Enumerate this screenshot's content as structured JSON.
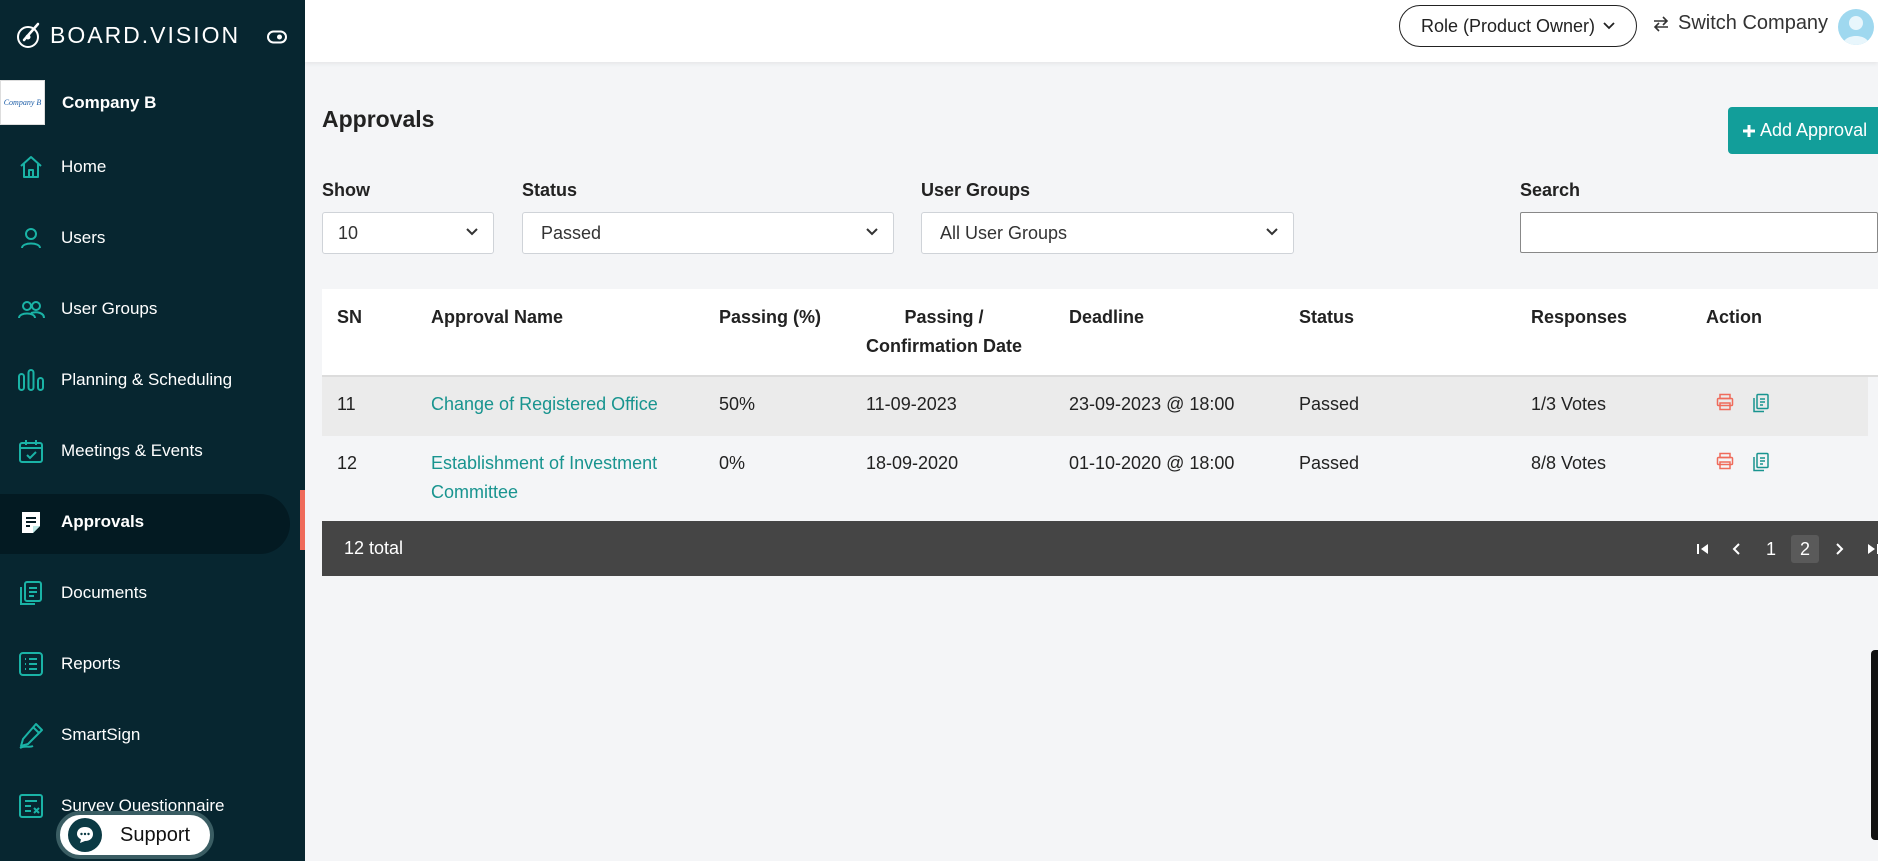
{
  "brand": {
    "name": "BOARD.VISION"
  },
  "company": {
    "logo_text": "Company B",
    "name": "Company B"
  },
  "sidebar": {
    "items": [
      {
        "label": "Home",
        "icon": "home-icon"
      },
      {
        "label": "Users",
        "icon": "user-icon"
      },
      {
        "label": "User Groups",
        "icon": "users-icon"
      },
      {
        "label": "Planning & Scheduling",
        "icon": "bar-chart-icon"
      },
      {
        "label": "Meetings & Events",
        "icon": "calendar-icon"
      },
      {
        "label": "Approvals",
        "icon": "approval-icon",
        "active": true
      },
      {
        "label": "Documents",
        "icon": "documents-icon"
      },
      {
        "label": "Reports",
        "icon": "list-icon"
      },
      {
        "label": "SmartSign",
        "icon": "pen-icon"
      },
      {
        "label": "Survey Questionnaire",
        "icon": "survey-icon"
      }
    ]
  },
  "support": {
    "label": "Support"
  },
  "header": {
    "role_label": "Role (Product Owner)",
    "switch_label": "Switch Company"
  },
  "page": {
    "title": "Approvals",
    "add_label": "Add Approval"
  },
  "filters": {
    "show": {
      "label": "Show",
      "value": "10"
    },
    "status": {
      "label": "Status",
      "value": "Passed"
    },
    "user_groups": {
      "label": "User Groups",
      "value": "All User Groups"
    },
    "search": {
      "label": "Search",
      "value": ""
    }
  },
  "table": {
    "columns": {
      "sn": "SN",
      "name": "Approval Name",
      "passing": "Passing (%)",
      "date_line1": "Passing /",
      "date_line2": "Confirmation Date",
      "deadline": "Deadline",
      "status": "Status",
      "responses": "Responses",
      "action": "Action"
    },
    "rows": [
      {
        "sn": "11",
        "name": "Change of Registered Office",
        "passing": "50%",
        "date": "11-09-2023",
        "deadline": "23-09-2023 @ 18:00",
        "status": "Passed",
        "responses": "1/3 Votes"
      },
      {
        "sn": "12",
        "name": "Establishment of Investment Committee",
        "passing": "0%",
        "date": "18-09-2020",
        "deadline": "01-10-2020 @ 18:00",
        "status": "Passed",
        "responses": "8/8 Votes"
      }
    ],
    "total": "12 total",
    "pages": [
      "1",
      "2"
    ],
    "current_page": "2"
  },
  "colors": {
    "sidebar": "#072630",
    "accent": "#129e9a",
    "link": "#18948f",
    "print_icon": "#ef6b5b"
  }
}
